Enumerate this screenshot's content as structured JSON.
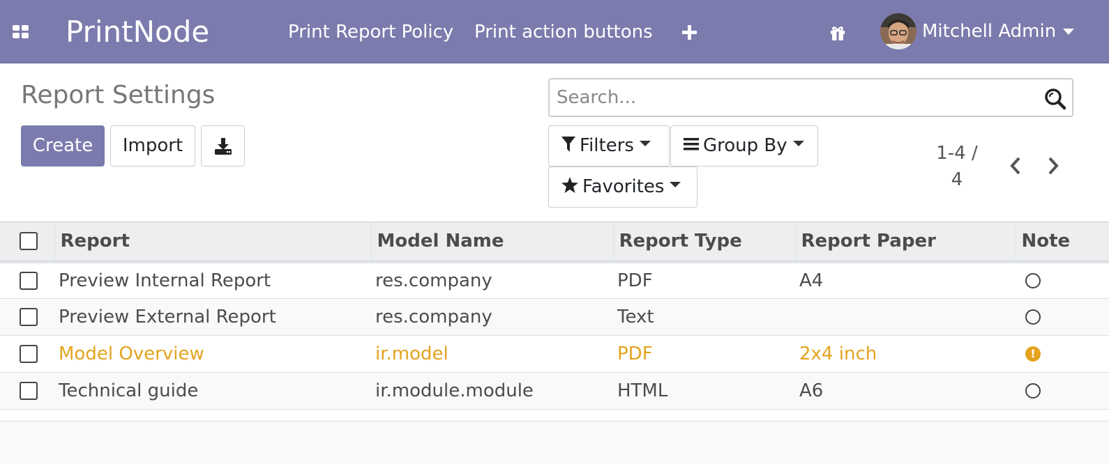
{
  "navbar": {
    "brand": "PrintNode",
    "menu": [
      {
        "label": "Print Report Policy"
      },
      {
        "label": "Print action buttons"
      }
    ],
    "user_name": "Mitchell Admin",
    "icons": [
      "apps-grid-icon",
      "plus-icon",
      "gift-icon",
      "chevron-down-icon"
    ]
  },
  "control_panel": {
    "title": "Report Settings",
    "create_label": "Create",
    "import_label": "Import",
    "search_placeholder": "Search...",
    "filters_label": "Filters",
    "group_by_label": "Group By",
    "favorites_label": "Favorites",
    "pager_range": "1-4 /",
    "pager_total": "4"
  },
  "table": {
    "columns": [
      "Report",
      "Model Name",
      "Report Type",
      "Report Paper",
      "Note"
    ],
    "rows": [
      {
        "report": "Preview Internal Report",
        "model": "res.company",
        "type": "PDF",
        "paper": "A4",
        "note": "circle"
      },
      {
        "report": "Preview External Report",
        "model": "res.company",
        "type": "Text",
        "paper": "",
        "note": "circle"
      },
      {
        "report": "Model Overview",
        "model": "ir.model",
        "type": "PDF",
        "paper": "2x4 inch",
        "note": "warning"
      },
      {
        "report": "Technical guide",
        "model": "ir.module.module",
        "type": "HTML",
        "paper": "A6",
        "note": "circle"
      }
    ]
  },
  "colors": {
    "navbar": "#7c7bad",
    "primary": "#7c7bad",
    "warning": "#e3a31d"
  }
}
